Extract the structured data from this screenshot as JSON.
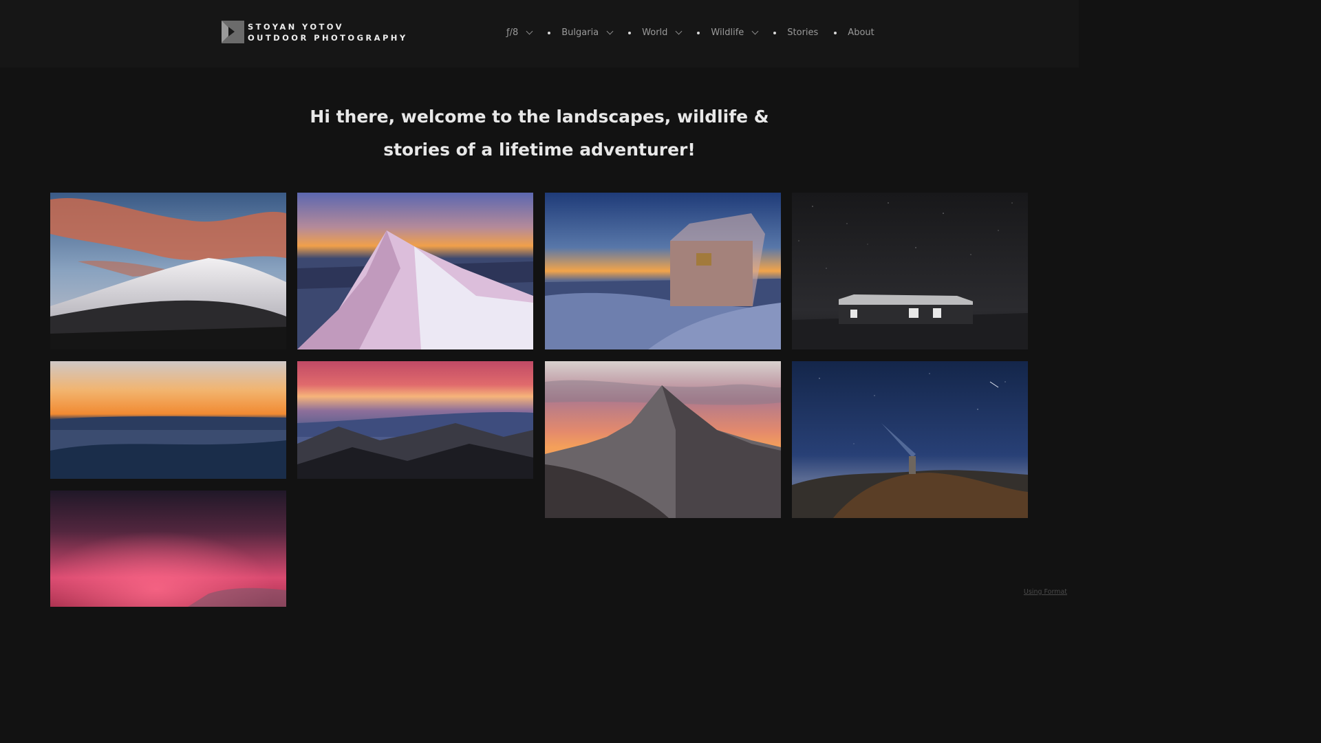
{
  "brand": {
    "line1": "STOYAN YOTOV",
    "line2": "OUTDOOR PHOTOGRAPHY"
  },
  "nav": {
    "items": [
      {
        "label": "ƒ/8",
        "has_dropdown": true
      },
      {
        "label": "Bulgaria",
        "has_dropdown": true
      },
      {
        "label": "World",
        "has_dropdown": true
      },
      {
        "label": "Wildlife",
        "has_dropdown": true
      },
      {
        "label": "Stories",
        "has_dropdown": false
      },
      {
        "label": "About",
        "has_dropdown": false
      }
    ]
  },
  "hero": {
    "line1": "Hi there, welcome to the landscapes, wildlife &",
    "line2": "stories of a lifetime adventurer!"
  },
  "gallery": {
    "photos": [
      "sunset-clouds-over-snowy-mountain",
      "pink-lit-snowy-ridge",
      "snow-covered-hut-at-dusk",
      "buried-hut-under-stars",
      "orange-horizon-over-cloud-sea",
      "layered-mountain-ridges-at-dusk",
      "rocky-peak-at-sunset",
      "night-sky-with-monument",
      "red-aurora-sky"
    ]
  },
  "footer": {
    "credit": "Using Format"
  },
  "colors": {
    "background": "#121212",
    "header": "#161616",
    "text": "#e8e8e8",
    "nav_text": "#9a9a9a"
  }
}
